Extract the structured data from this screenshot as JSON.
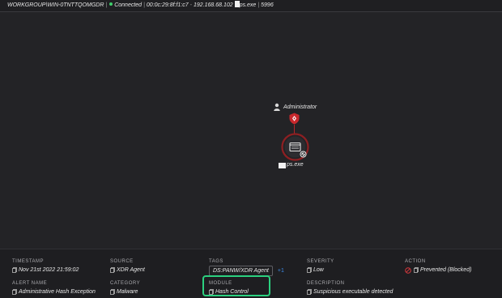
{
  "header": {
    "host": "WORKGROUP\\WIN-0TNTTQOMGDR",
    "status": "Connected",
    "mac": "00:0c:29:8f:f1:c7",
    "ip": "192.168.68.102",
    "process": "ps.exe",
    "pid": "5996",
    "status_color": "#3fcf6b"
  },
  "graph": {
    "user_label": "Administrator",
    "process_label": "ps.exe",
    "user_icon": "user-icon",
    "alert_icon": "shield-alert-icon",
    "process_icon": "window-icon",
    "blocked_icon": "blocked-icon",
    "alert_color": "#c8282d"
  },
  "details": {
    "timestamp": {
      "label": "TIMESTAMP",
      "value": "Nov 21st 2022 21:59:02"
    },
    "source": {
      "label": "SOURCE",
      "value": "XDR Agent"
    },
    "tags": {
      "label": "TAGS",
      "value": "DS:PANW/XDR Agent",
      "extra": "+1"
    },
    "severity": {
      "label": "SEVERITY",
      "value": "Low"
    },
    "action": {
      "label": "ACTION",
      "value": "Prevented (Blocked)"
    },
    "alert_name": {
      "label": "ALERT NAME",
      "value": "Administrative Hash Exception"
    },
    "category": {
      "label": "CATEGORY",
      "value": "Malware"
    },
    "module": {
      "label": "MODULE",
      "value": "Hash Control"
    },
    "description": {
      "label": "DESCRIPTION",
      "value": "Suspicious executable detected"
    },
    "highlight_color": "#2bd17f"
  }
}
